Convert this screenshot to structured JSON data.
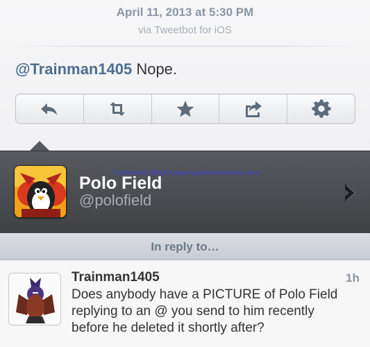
{
  "header": {
    "date": "April 11, 2013 at 5:30 PM",
    "via": "via Tweetbot for iOS"
  },
  "tweet": {
    "mention": "@Trainman1405",
    "text": " Nope."
  },
  "actions": [
    {
      "icon": "reply-icon"
    },
    {
      "icon": "retweet-icon"
    },
    {
      "icon": "star-icon"
    },
    {
      "icon": "share-icon"
    },
    {
      "icon": "gear-icon"
    }
  ],
  "profile": {
    "name": "Polo Field",
    "handle": "@polofield",
    "watermark": "Trainman1405/clubpenguinmemories.com"
  },
  "reply_section": {
    "label": "In reply to…",
    "user": "Trainman1405",
    "time": "1h",
    "text": "Does anybody have a PICTURE of Polo Field replying to an @ you send to him recently before he deleted it shortly after?"
  },
  "colors": {
    "mention": "#4c6d8f",
    "profile_bg": "#4a4d51",
    "icon": "#5d6c7c"
  }
}
